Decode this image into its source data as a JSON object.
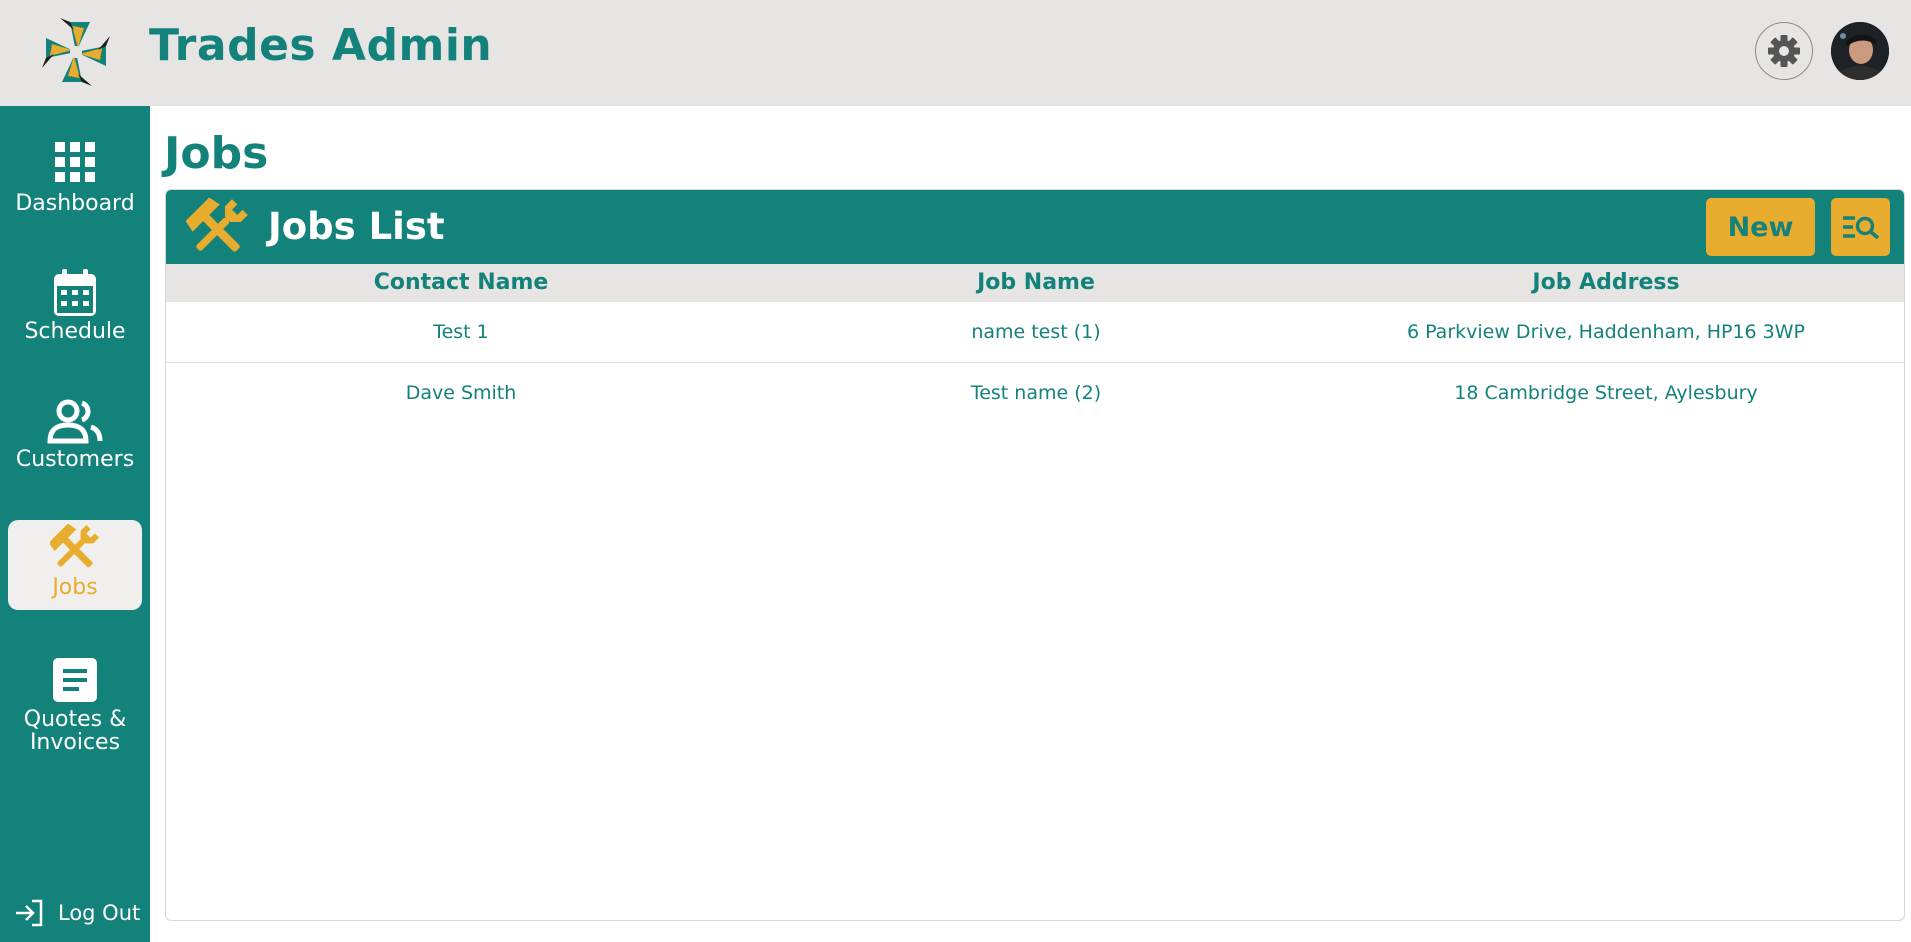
{
  "app": {
    "title": "Trades Admin"
  },
  "sidebar": {
    "items": [
      {
        "label": "Dashboard",
        "icon": "grid-icon"
      },
      {
        "label": "Schedule",
        "icon": "calendar-icon"
      },
      {
        "label": "Customers",
        "icon": "users-icon"
      },
      {
        "label": "Jobs",
        "icon": "tools-icon",
        "active": true
      },
      {
        "label": "Quotes & Invoices",
        "label_line1": "Quotes &",
        "label_line2": "Invoices",
        "icon": "document-icon"
      }
    ],
    "logout_label": "Log Out"
  },
  "page": {
    "title": "Jobs"
  },
  "panel": {
    "title": "Jobs List",
    "new_label": "New",
    "columns": [
      "Contact Name",
      "Job Name",
      "Job Address"
    ],
    "rows": [
      {
        "contact": "Test 1",
        "job": "name test (1)",
        "address": "6 Parkview Drive, Haddenham, HP16 3WP"
      },
      {
        "contact": "Dave Smith",
        "job": "Test name (2)",
        "address": "18 Cambridge Street, Aylesbury"
      }
    ]
  },
  "colors": {
    "teal": "#13827a",
    "gold": "#e8ac2e",
    "grey": "#e6e5e3"
  }
}
